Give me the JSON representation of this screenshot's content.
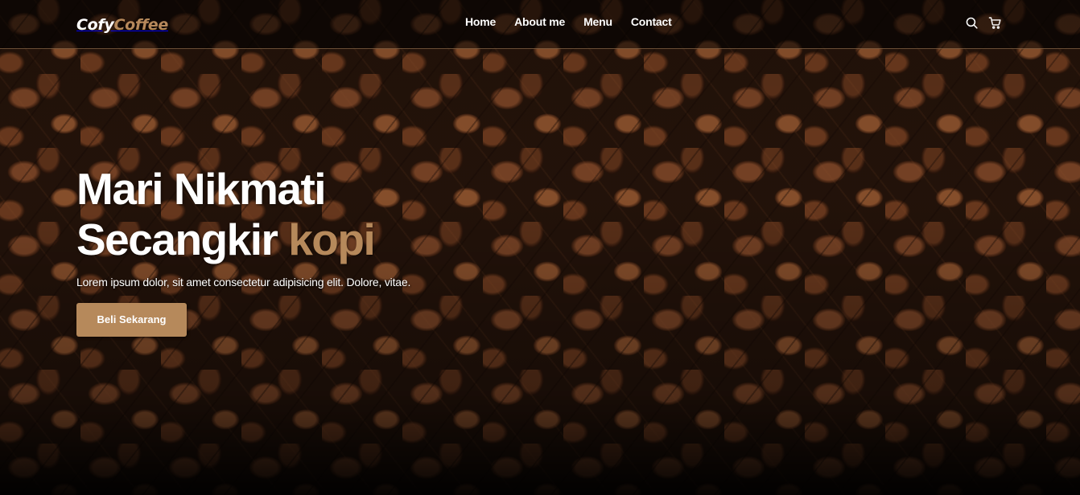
{
  "brand": {
    "name_part1": "Cofy",
    "name_part2": "Coffee",
    "accent_color": "#b6895b"
  },
  "nav": {
    "links": [
      {
        "label": "Home"
      },
      {
        "label": "About me"
      },
      {
        "label": "Menu"
      },
      {
        "label": "Contact"
      }
    ],
    "icons": [
      "search-icon",
      "shopping-cart-icon"
    ]
  },
  "hero": {
    "title_line1": "Mari Nikmati",
    "title_line2": "Secangkir",
    "title_accent": "kopi",
    "description": "Lorem ipsum dolor, sit amet consectetur adipisicing elit. Dolore, vitae.",
    "cta_label": "Beli Sekarang",
    "background": "coffee-beans-image"
  }
}
